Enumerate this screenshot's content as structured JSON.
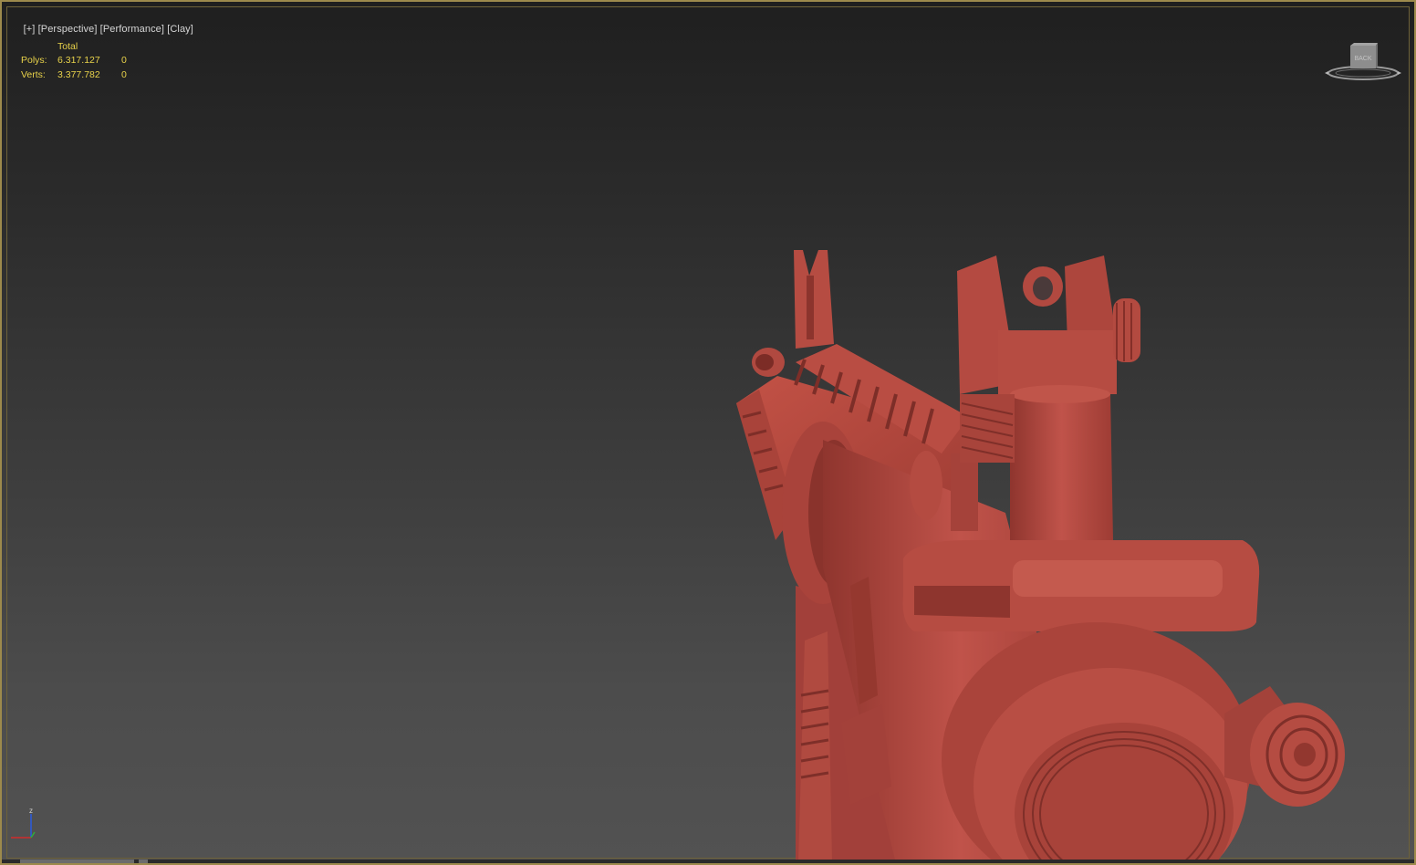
{
  "viewport": {
    "label_items": [
      "[+]",
      "[Perspective]",
      "[Performance]",
      "[Clay]"
    ]
  },
  "stats": {
    "header": "Total",
    "rows": [
      {
        "label": "Polys:",
        "total": "6.317.127",
        "selected": "0"
      },
      {
        "label": "Verts:",
        "total": "3.377.782",
        "selected": "0"
      }
    ]
  },
  "viewcube": {
    "face": "BACK",
    "icon": "viewcube-icon"
  },
  "axis_gizmo": {
    "z_label": "z",
    "icon": "axis-gizmo-icon"
  },
  "colors": {
    "clay": "#b5473d",
    "clay_dark": "#7f2e28",
    "clay_light": "#c9584c",
    "border": "#9d8a4c",
    "stats_text": "#e8d24a"
  }
}
